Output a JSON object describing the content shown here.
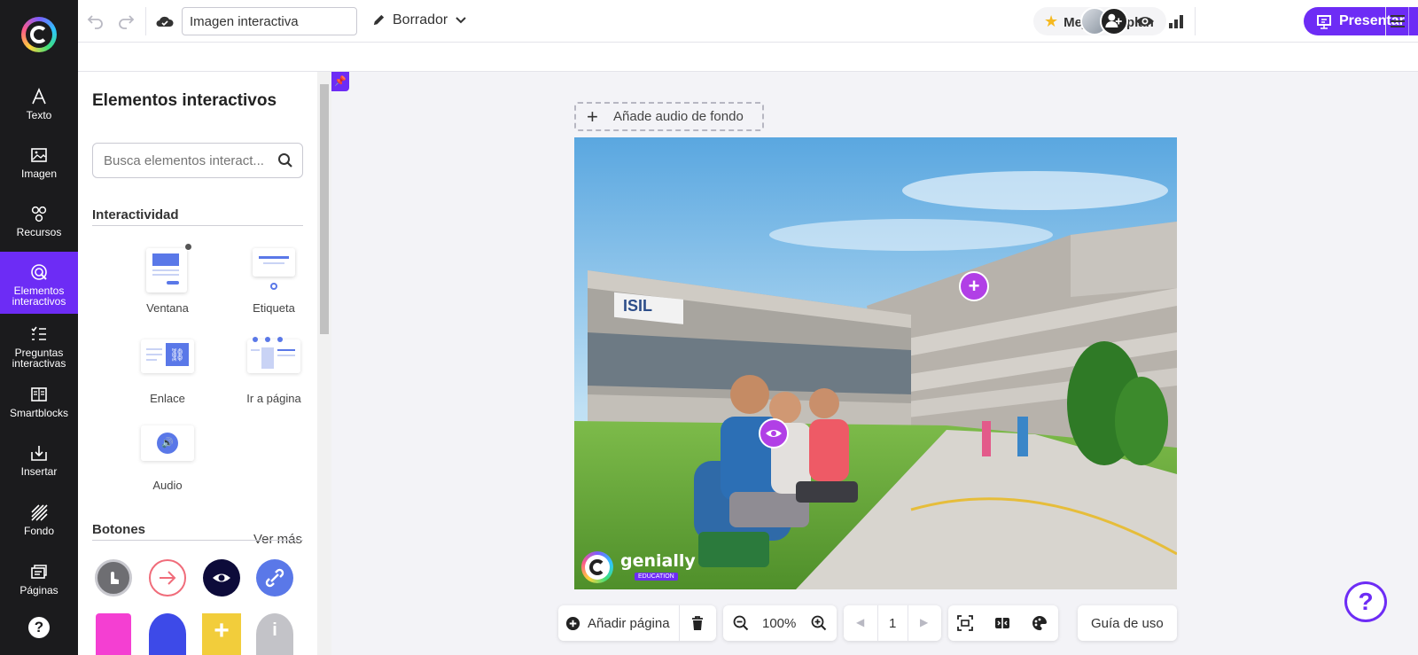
{
  "app": {
    "title_value": "Imagen interactiva",
    "draft_label": "Borrador",
    "upgrade_label": "Mejora tu plan",
    "present_label": "Presentar",
    "accent_color": "#6d2cf5"
  },
  "rail": {
    "items": [
      {
        "label": "Texto",
        "icon": "text-icon"
      },
      {
        "label": "Imagen",
        "icon": "image-icon"
      },
      {
        "label": "Recursos",
        "icon": "resources-icon"
      },
      {
        "label": "Elementos interactivos",
        "icon": "interactive-icon"
      },
      {
        "label": "Preguntas interactivas",
        "icon": "questions-icon"
      },
      {
        "label": "Smartblocks",
        "icon": "smartblocks-icon"
      },
      {
        "label": "Insertar",
        "icon": "insert-icon"
      },
      {
        "label": "Fondo",
        "icon": "background-icon"
      },
      {
        "label": "Páginas",
        "icon": "pages-icon"
      }
    ],
    "help_label": "?"
  },
  "panel": {
    "title": "Elementos interactivos",
    "search_placeholder": "Busca elementos interact...",
    "interactivity_title": "Interactividad",
    "items": [
      {
        "label": "Ventana"
      },
      {
        "label": "Etiqueta"
      },
      {
        "label": "Enlace"
      },
      {
        "label": "Ir a página"
      },
      {
        "label": "Audio"
      }
    ],
    "buttons_title": "Botones",
    "see_more": "Ver más"
  },
  "canvas": {
    "audio_label": "Añade audio de fondo",
    "brand_word": "genially",
    "brand_sub": "EDUCATION",
    "building_sign": "ISIL"
  },
  "bottom": {
    "add_page": "Añadir página",
    "zoom": "100%",
    "page_number": "1",
    "guide": "Guía de uso"
  }
}
